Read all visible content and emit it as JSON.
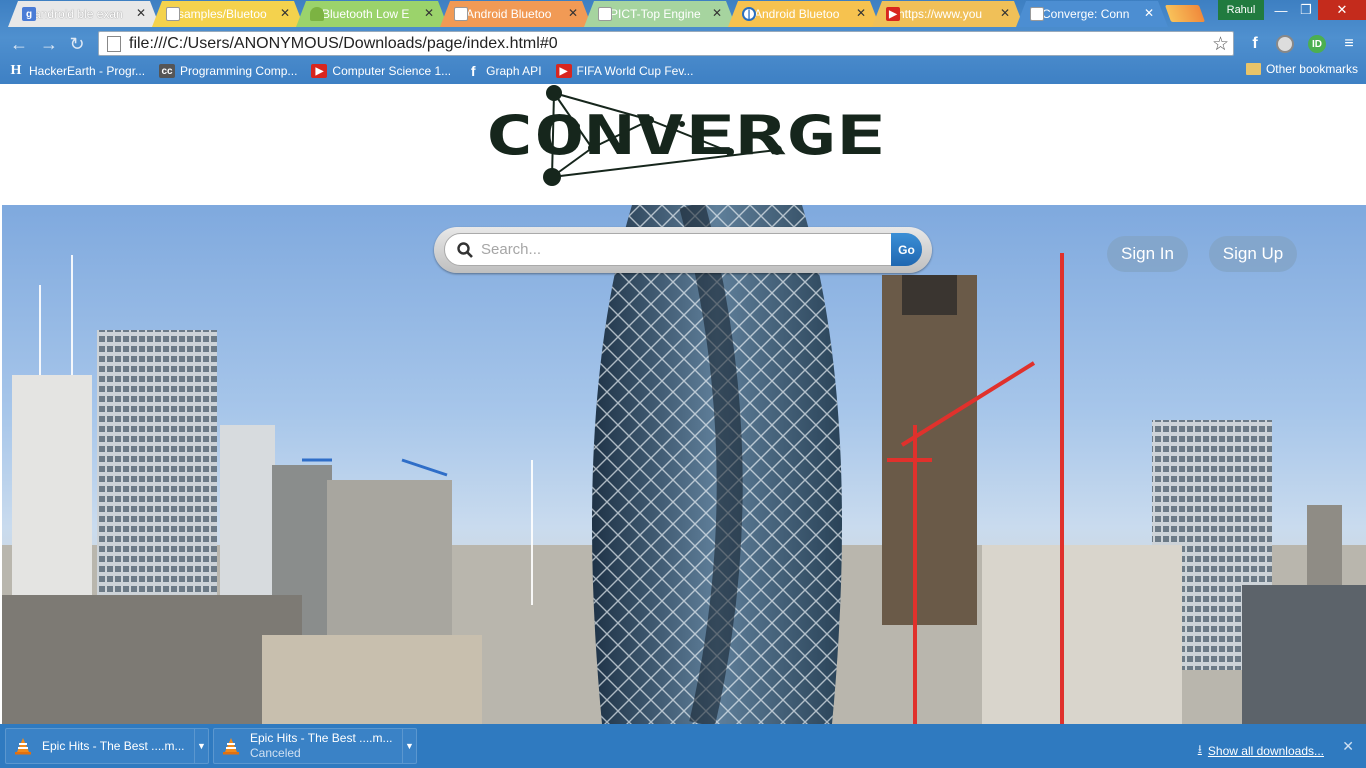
{
  "browser": {
    "tabs": [
      {
        "title": "android ble exan",
        "favicon": "google-icon",
        "color": "#e8e8e8"
      },
      {
        "title": "samples/Bluetoo",
        "favicon": "page-icon",
        "color": "#f4d24d"
      },
      {
        "title": "Bluetooth Low E",
        "favicon": "android-icon",
        "color": "#9bd36b"
      },
      {
        "title": "Android Bluetoo",
        "favicon": "page-icon",
        "color": "#f19a55"
      },
      {
        "title": "PICT-Top Engine",
        "favicon": "page-icon",
        "color": "#a6d49f"
      },
      {
        "title": "Android Bluetoo",
        "favicon": "power-icon",
        "color": "#f6c24f"
      },
      {
        "title": "https://www.you",
        "favicon": "youtube-icon",
        "color": "#f0c058"
      },
      {
        "title": "Converge: Conn",
        "favicon": "page-icon",
        "color": "#4c8ed2"
      }
    ],
    "user": "Rahul",
    "address": "file:///C:/Users/ANONYMOUS/Downloads/page/index.html#0",
    "bookmarks": [
      {
        "label": "HackerEarth - Progr...",
        "icon": "hackerearth-icon"
      },
      {
        "label": "Programming Comp...",
        "icon": "cc-icon"
      },
      {
        "label": "Computer Science 1...",
        "icon": "youtube-icon"
      },
      {
        "label": "Graph API",
        "icon": "facebook-icon"
      },
      {
        "label": "FIFA World Cup Fev...",
        "icon": "youtube-icon"
      }
    ],
    "other_bookmarks": "Other bookmarks"
  },
  "page": {
    "logo_text": "CONVERGE",
    "search_placeholder": "Search...",
    "go_label": "Go",
    "sign_in": "Sign In",
    "sign_up": "Sign Up"
  },
  "downloads": {
    "items": [
      {
        "name": "Epic Hits - The Best ....m...",
        "status": ""
      },
      {
        "name": "Epic Hits - The Best ....m...",
        "status": "Canceled"
      }
    ],
    "show_all": "Show all downloads..."
  }
}
